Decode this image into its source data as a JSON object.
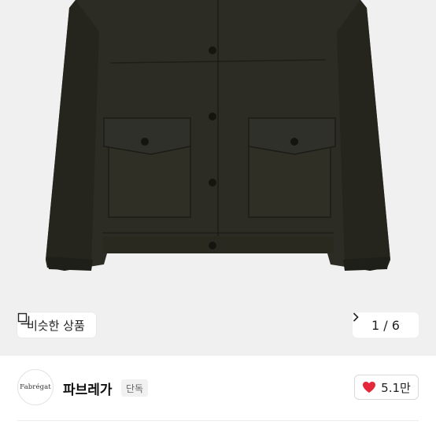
{
  "gallery": {
    "similar_label": "비슷한 상품",
    "current_page": "1",
    "page_separator": "/",
    "total_pages": "6",
    "similar_icon": "similar-items-icon",
    "next_icon": "chevron-right-icon"
  },
  "seller": {
    "logo_text": "Fabrégat",
    "name": "파브레가",
    "badge": "단독"
  },
  "like": {
    "count": "5.1만",
    "icon": "heart-icon",
    "color": "#e4283a"
  },
  "colors": {
    "jacket": "#2b2b22",
    "background": "#f0f0f0"
  }
}
